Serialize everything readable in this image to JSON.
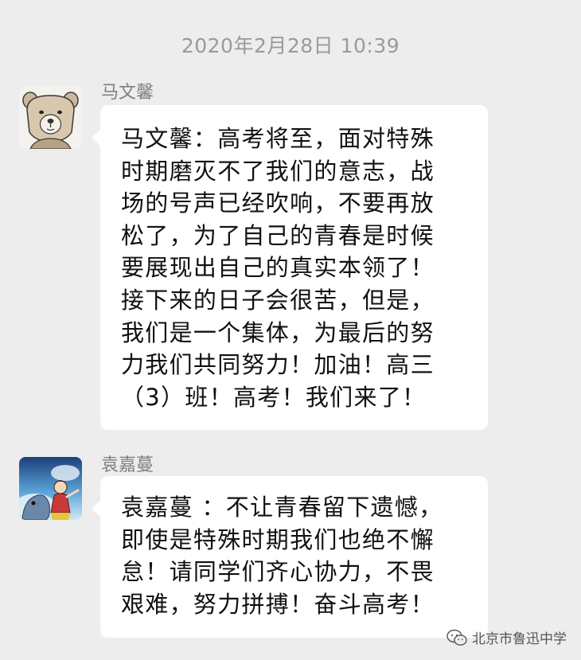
{
  "header": {
    "timestamp": "2020年2月28日 10:39"
  },
  "messages": [
    {
      "sender": "马文馨",
      "avatar_icon": "cartoon-bear-avatar",
      "text": "马文馨：高考将至，面对特殊\n时期磨灭不了我们的意志，战\n场的号声已经吹响，不要再放\n松了，为了自己的青春是时候\n要展现出自己的真实本领了！\n接下来的日子会很苦，但是，\n我们是一个集体，为最后的努\n力我们共同努力！加油！高三\n（3）班！高考！我们来了！"
    },
    {
      "sender": "袁嘉蔓",
      "avatar_icon": "anime-character-avatar",
      "text": "袁嘉蔓 ：不让青春留下遗憾，\n即使是特殊时期我们也绝不懈\n怠！请同学们齐心协力，不畏\n艰难，努力拼搏！奋斗高考！"
    }
  ],
  "watermark": {
    "icon": "wechat-icon",
    "text": "北京市鲁迅中学"
  },
  "colors": {
    "background": "#ededed",
    "bubble": "#ffffff",
    "timestamp": "#9a9a9a",
    "sender_name": "#7f7f7f"
  }
}
